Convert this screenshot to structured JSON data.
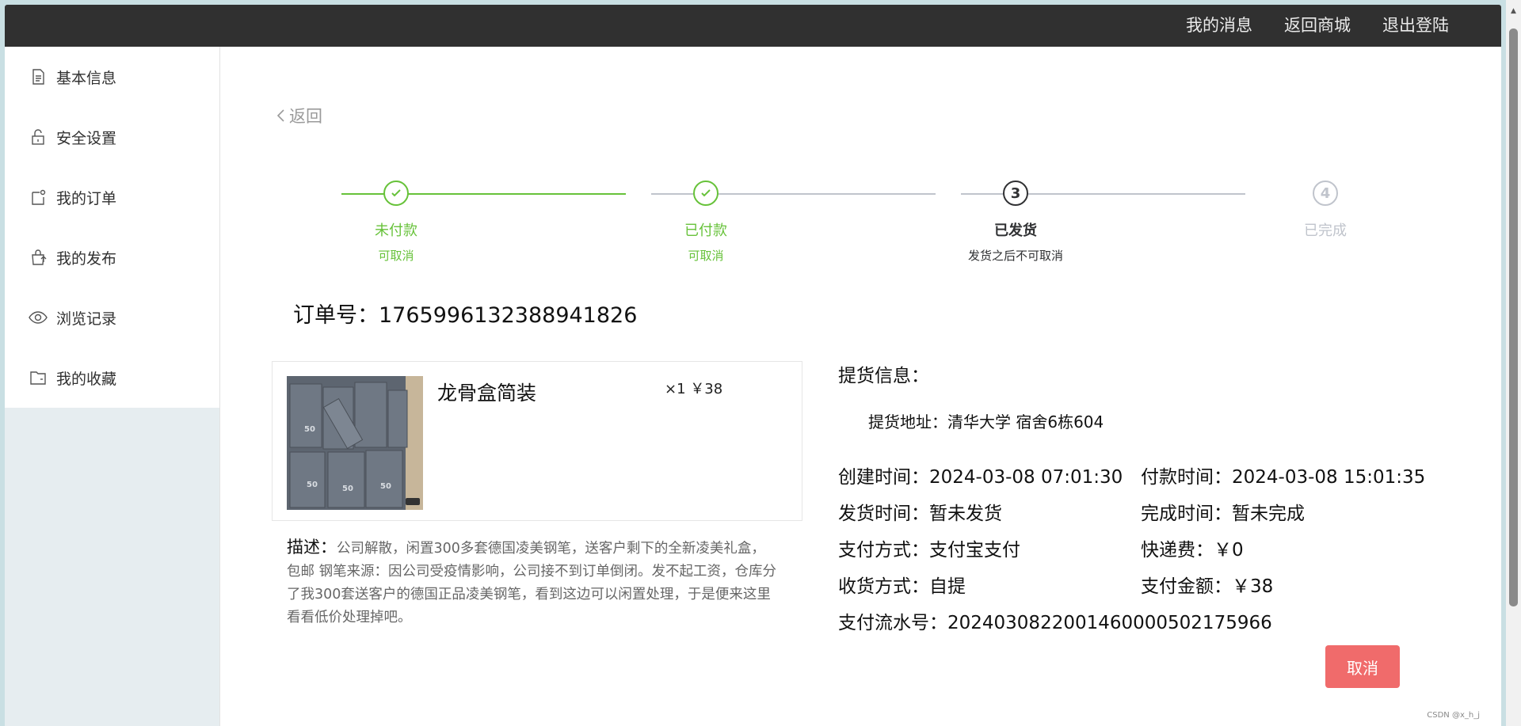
{
  "topnav": [
    "我的消息",
    "返回商城",
    "退出登陆"
  ],
  "sidebar": {
    "items": [
      {
        "label": "基本信息",
        "icon": "document-icon"
      },
      {
        "label": "安全设置",
        "icon": "lock-icon"
      },
      {
        "label": "我的订单",
        "icon": "order-icon"
      },
      {
        "label": "我的发布",
        "icon": "publish-bag-icon"
      },
      {
        "label": "浏览记录",
        "icon": "eye-icon"
      },
      {
        "label": "我的收藏",
        "icon": "folder-icon"
      }
    ]
  },
  "back_label": "返回",
  "steps": [
    {
      "title": "未付款",
      "desc": "可取消",
      "state": "done"
    },
    {
      "title": "已付款",
      "desc": "可取消",
      "state": "done"
    },
    {
      "title": "已发货",
      "desc": "发货之后不可取消",
      "state": "current",
      "number": "3"
    },
    {
      "title": "已完成",
      "desc": "",
      "state": "pending",
      "number": "4"
    }
  ],
  "order": {
    "label": "订单号：",
    "number": "1765996132388941826"
  },
  "product": {
    "name": "龙骨盒简装",
    "qty": "×1",
    "price": "￥38",
    "image_alt": "boxes"
  },
  "description": {
    "label": "描述：",
    "text": "公司解散，闲置300多套德国凌美钢笔，送客户剩下的全新凌美礼盒，包邮 钢笔来源：因公司受疫情影响，公司接不到订单倒闭。发不起工资，仓库分了我300套送客户的德国正品凌美钢笔，看到这边可以闲置处理，于是便来这里看看低价处理掉吧。"
  },
  "pickup": {
    "heading": "提货信息：",
    "address_label": "提货地址：",
    "address": "清华大学 宿舍6栋604"
  },
  "details": {
    "created_label": "创建时间：",
    "created": "2024-03-08 07:01:30",
    "paid_label": "付款时间：",
    "paid": "2024-03-08 15:01:35",
    "shipped_label": "发货时间：",
    "shipped": "暂未发货",
    "completed_label": "完成时间：",
    "completed": "暂未完成",
    "paymethod_label": "支付方式：",
    "paymethod": "支付宝支付",
    "shipping_label": "快递费：",
    "shipping": "￥0",
    "receive_label": "收货方式：",
    "receive": "自提",
    "amount_label": "支付金额：",
    "amount": "￥38",
    "serial_label": "支付流水号：",
    "serial": "2024030822001460000502175966"
  },
  "cancel_label": "取消",
  "watermark": "CSDN @x_h_j",
  "colors": {
    "done": "#67c23a",
    "current": "#303133",
    "pending": "#c0c4cc",
    "cancel": "#f06b6b"
  }
}
